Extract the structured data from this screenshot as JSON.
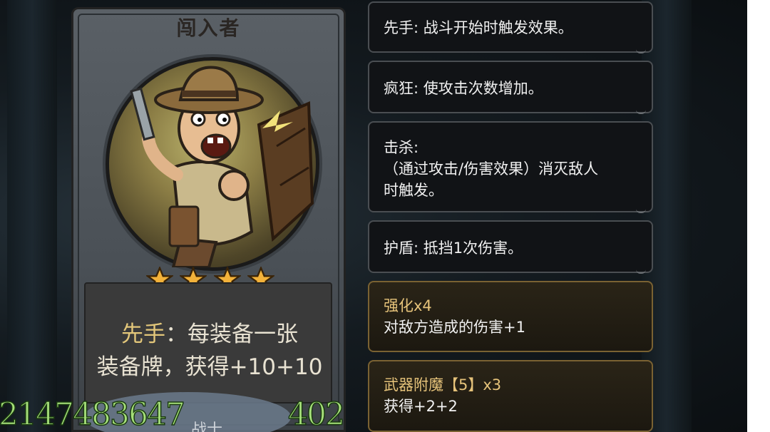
{
  "card": {
    "name": "闯入者",
    "stars": 4,
    "description_keyword": "先手",
    "description_line1_rest": "：每装备一张",
    "description_line2": "装备牌，获得+10+10",
    "class_label": "战士",
    "attack": "2147483647",
    "health": "402"
  },
  "panels": [
    {
      "text": "先手: 战斗开始时触发效果。",
      "style": "dark"
    },
    {
      "text": "疯狂: 使攻击次数增加。",
      "style": "dark"
    },
    {
      "line1": "击杀:",
      "line2": "（通过攻击/伤害效果）消灭敌人",
      "line3": "时触发。",
      "style": "dark"
    },
    {
      "text": "护盾: 抵挡1次伤害。",
      "style": "dark"
    },
    {
      "title": "强化x4",
      "body": "对敌方造成的伤害+1",
      "style": "gold"
    },
    {
      "title": "武器附魔【5】x3",
      "body": "获得+2+2",
      "style": "gold"
    }
  ],
  "colors": {
    "keyword_gold": "#e3c77a",
    "number_green": "#a6e07a",
    "panel_border": "#4a4e52"
  }
}
